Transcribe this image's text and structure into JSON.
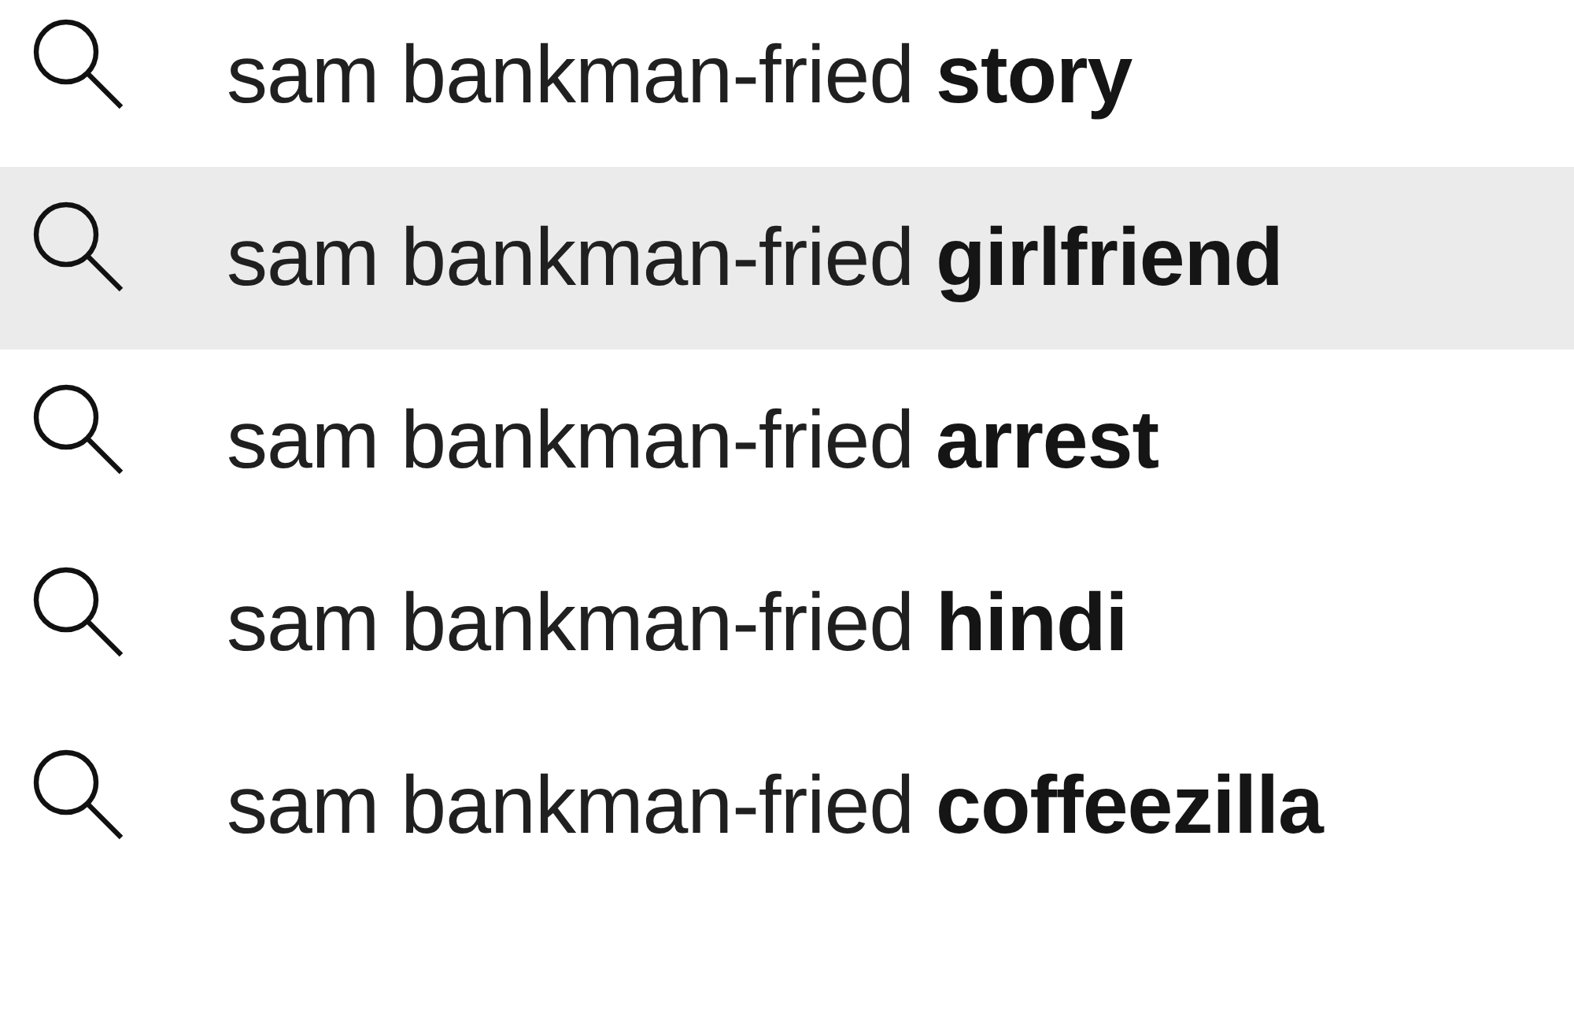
{
  "suggestions": [
    {
      "text": "sam bankman-fried **story**",
      "selected": false
    },
    {
      "text": "sam bankman-fried **girlfriend**",
      "selected": true
    },
    {
      "text": "sam bankman-fried **arrest**",
      "selected": false
    },
    {
      "text": "sam bankman-fried **hindi**",
      "selected": false
    },
    {
      "text": "sam bankman-fried **coffeezilla**",
      "selected": false
    }
  ]
}
